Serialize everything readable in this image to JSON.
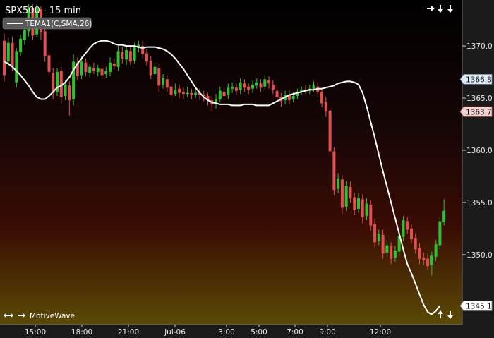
{
  "chart_title": "SPX500 - 15 min",
  "legend_label": "TEMA1(C,SMA,26)",
  "brand": "MotiveWave",
  "colors": {
    "up": "#2fc22f",
    "down": "#e05050",
    "indicator": "#ffffff",
    "bg_top": "#000000",
    "bg_mid": "#170606",
    "bg_red": "#3a0c04",
    "bg_bottom": "#5a4a05",
    "axis_bg": "#1a1a1a",
    "label_blue": "#dfe9f3",
    "label_pink": "#f1d0d0"
  },
  "icons": {
    "top_right": [
      "right-arrow-icon",
      "down-arrow-icon",
      "down-arrow-icon"
    ],
    "bottom_left": [
      "left-right-arrow-icon",
      "right-arrow-icon"
    ],
    "bottom_right": [
      "up-arrow-icon",
      "down-arrow-icon"
    ]
  },
  "chart_data": {
    "type": "candlestick",
    "title": "SPX500 - 15 min",
    "ylim": [
      1343.3,
      1374.4
    ],
    "x_ticks": [
      "15:00",
      "18:00",
      "21:00",
      "Jul-06",
      "3:00",
      "5:00",
      "7:00",
      "9:00",
      "12:00"
    ],
    "y_ticks": [
      1345.0,
      1350.0,
      1355.0,
      1360.0,
      1365.0,
      1370.0
    ],
    "price_labels": [
      {
        "value": 1366.8,
        "style": "blue"
      },
      {
        "value": 1363.7,
        "style": "pink"
      },
      {
        "value": 1345.1,
        "style": "white"
      }
    ],
    "candles": [
      [
        1370.5,
        1367.2,
        1371.2,
        1366.6
      ],
      [
        1368.5,
        1370.3,
        1370.8,
        1368.0
      ],
      [
        1370.3,
        1368.0,
        1370.9,
        1367.6
      ],
      [
        1366.5,
        1369.5,
        1369.8,
        1366.0
      ],
      [
        1369.4,
        1370.7,
        1371.1,
        1369.0
      ],
      [
        1370.6,
        1371.5,
        1372.3,
        1370.1
      ],
      [
        1371.4,
        1373.7,
        1374.0,
        1370.9
      ],
      [
        1373.6,
        1371.0,
        1374.0,
        1370.6
      ],
      [
        1371.1,
        1373.6,
        1374.0,
        1370.8
      ],
      [
        1373.5,
        1371.3,
        1373.8,
        1370.6
      ],
      [
        1371.4,
        1369.0,
        1371.9,
        1368.5
      ],
      [
        1369.1,
        1367.5,
        1369.5,
        1367.0
      ],
      [
        1367.4,
        1365.5,
        1367.9,
        1364.9
      ],
      [
        1365.6,
        1367.5,
        1367.9,
        1365.2
      ],
      [
        1367.6,
        1365.1,
        1368.0,
        1364.5
      ],
      [
        1365.2,
        1366.3,
        1366.7,
        1364.8
      ],
      [
        1366.2,
        1364.8,
        1366.6,
        1363.3
      ],
      [
        1364.9,
        1368.5,
        1369.2,
        1364.3
      ],
      [
        1368.4,
        1367.1,
        1368.9,
        1366.7
      ],
      [
        1367.2,
        1368.5,
        1369.0,
        1366.8
      ],
      [
        1368.4,
        1367.5,
        1368.8,
        1367.1
      ],
      [
        1367.4,
        1368.0,
        1368.3,
        1367.0
      ],
      [
        1367.9,
        1367.6,
        1368.4,
        1367.3
      ],
      [
        1367.5,
        1367.9,
        1368.2,
        1367.1
      ],
      [
        1367.8,
        1367.2,
        1368.2,
        1366.9
      ],
      [
        1367.3,
        1367.6,
        1368.0,
        1366.9
      ],
      [
        1367.5,
        1368.4,
        1368.9,
        1367.1
      ],
      [
        1368.3,
        1368.1,
        1368.8,
        1367.7
      ],
      [
        1368.0,
        1369.5,
        1370.0,
        1367.6
      ],
      [
        1369.4,
        1368.8,
        1369.9,
        1368.3
      ],
      [
        1368.7,
        1369.6,
        1370.0,
        1368.2
      ],
      [
        1369.5,
        1368.5,
        1369.9,
        1368.2
      ],
      [
        1368.6,
        1369.9,
        1370.3,
        1368.3
      ],
      [
        1369.8,
        1370.1,
        1370.5,
        1369.4
      ],
      [
        1370.0,
        1369.2,
        1370.5,
        1368.8
      ],
      [
        1369.3,
        1368.5,
        1369.7,
        1368.1
      ],
      [
        1368.6,
        1367.2,
        1369.0,
        1366.8
      ],
      [
        1367.3,
        1368.0,
        1368.4,
        1366.9
      ],
      [
        1367.9,
        1366.2,
        1368.3,
        1365.6
      ],
      [
        1366.3,
        1366.9,
        1367.3,
        1365.9
      ],
      [
        1366.8,
        1366.0,
        1367.2,
        1365.6
      ],
      [
        1366.1,
        1365.3,
        1366.6,
        1364.9
      ],
      [
        1365.4,
        1365.8,
        1366.4,
        1365.2
      ],
      [
        1365.9,
        1365.5,
        1366.3,
        1365.0
      ],
      [
        1365.6,
        1365.4,
        1366.0,
        1364.9
      ],
      [
        1365.4,
        1365.5,
        1366.1,
        1365.1
      ],
      [
        1365.5,
        1365.3,
        1365.9,
        1364.9
      ],
      [
        1365.3,
        1365.5,
        1366.0,
        1365.0
      ],
      [
        1365.5,
        1365.3,
        1365.9,
        1364.8
      ],
      [
        1365.3,
        1365.2,
        1365.7,
        1364.7
      ],
      [
        1365.2,
        1364.8,
        1365.5,
        1364.3
      ],
      [
        1364.8,
        1364.4,
        1365.2,
        1363.7
      ],
      [
        1364.4,
        1364.9,
        1365.4,
        1364.0
      ],
      [
        1364.9,
        1365.7,
        1366.1,
        1364.6
      ],
      [
        1365.6,
        1365.2,
        1366.0,
        1364.8
      ],
      [
        1365.3,
        1366.0,
        1366.4,
        1364.9
      ],
      [
        1365.9,
        1366.1,
        1366.5,
        1365.5
      ],
      [
        1366.0,
        1365.7,
        1366.4,
        1365.3
      ],
      [
        1365.8,
        1366.5,
        1366.9,
        1365.4
      ],
      [
        1366.4,
        1366.0,
        1366.8,
        1365.6
      ],
      [
        1366.1,
        1365.8,
        1366.4,
        1365.4
      ],
      [
        1365.9,
        1366.3,
        1366.7,
        1365.5
      ],
      [
        1366.2,
        1366.5,
        1366.9,
        1365.9
      ],
      [
        1366.4,
        1366.0,
        1366.8,
        1365.6
      ],
      [
        1366.1,
        1366.8,
        1367.2,
        1365.8
      ],
      [
        1366.7,
        1366.4,
        1367.1,
        1365.9
      ],
      [
        1366.3,
        1365.8,
        1366.7,
        1365.4
      ],
      [
        1365.7,
        1365.1,
        1366.1,
        1364.6
      ],
      [
        1365.1,
        1364.7,
        1365.5,
        1364.2
      ],
      [
        1364.8,
        1365.3,
        1365.7,
        1364.4
      ],
      [
        1365.3,
        1364.8,
        1365.7,
        1364.4
      ],
      [
        1364.9,
        1365.2,
        1365.6,
        1364.6
      ],
      [
        1365.2,
        1365.6,
        1365.9,
        1364.9
      ],
      [
        1365.6,
        1365.8,
        1366.1,
        1365.3
      ],
      [
        1365.8,
        1365.7,
        1366.2,
        1365.4
      ],
      [
        1365.7,
        1365.9,
        1366.3,
        1365.4
      ],
      [
        1365.9,
        1366.2,
        1366.6,
        1365.6
      ],
      [
        1366.1,
        1365.6,
        1366.5,
        1365.1
      ],
      [
        1365.6,
        1364.5,
        1365.9,
        1364.1
      ],
      [
        1364.6,
        1363.7,
        1365.1,
        1363.2
      ],
      [
        1363.8,
        1359.9,
        1364.1,
        1359.5
      ],
      [
        1359.9,
        1356.2,
        1360.3,
        1355.7
      ],
      [
        1356.3,
        1357.3,
        1357.8,
        1355.9
      ],
      [
        1357.2,
        1354.5,
        1357.6,
        1353.9
      ],
      [
        1354.6,
        1356.6,
        1357.1,
        1354.2
      ],
      [
        1356.5,
        1355.4,
        1357.0,
        1355.0
      ],
      [
        1355.5,
        1354.3,
        1355.9,
        1353.8
      ],
      [
        1354.4,
        1355.4,
        1355.9,
        1354.0
      ],
      [
        1355.3,
        1353.6,
        1355.8,
        1353.0
      ],
      [
        1353.7,
        1354.9,
        1355.4,
        1353.3
      ],
      [
        1354.8,
        1352.8,
        1355.2,
        1352.3
      ],
      [
        1352.9,
        1351.2,
        1353.4,
        1350.7
      ],
      [
        1351.3,
        1352.0,
        1352.4,
        1350.9
      ],
      [
        1351.9,
        1350.1,
        1352.4,
        1349.6
      ],
      [
        1350.2,
        1350.9,
        1351.4,
        1349.8
      ],
      [
        1350.8,
        1349.6,
        1351.2,
        1349.1
      ],
      [
        1349.7,
        1350.4,
        1350.8,
        1349.3
      ],
      [
        1350.3,
        1351.8,
        1352.2,
        1349.9
      ],
      [
        1351.7,
        1353.3,
        1353.7,
        1351.3
      ],
      [
        1353.2,
        1352.4,
        1353.6,
        1352.0
      ],
      [
        1352.5,
        1351.5,
        1352.9,
        1351.1
      ],
      [
        1351.6,
        1350.5,
        1352.0,
        1350.1
      ],
      [
        1350.6,
        1349.6,
        1351.1,
        1349.1
      ],
      [
        1349.7,
        1349.5,
        1350.2,
        1349.0
      ],
      [
        1349.6,
        1348.9,
        1350.1,
        1348.5
      ],
      [
        1349.0,
        1349.9,
        1350.3,
        1348.0
      ],
      [
        1349.8,
        1351.0,
        1351.4,
        1349.4
      ],
      [
        1350.9,
        1353.2,
        1353.6,
        1350.5
      ],
      [
        1353.1,
        1354.2,
        1355.3,
        1352.8
      ]
    ],
    "indicator": {
      "name": "TEMA1(C,SMA,26)",
      "values": [
        1368.5,
        1368.3,
        1368.0,
        1367.6,
        1367.2,
        1366.7,
        1366.2,
        1365.6,
        1365.1,
        1364.9,
        1364.9,
        1365.2,
        1365.6,
        1366.0,
        1366.2,
        1366.5,
        1367.0,
        1367.7,
        1368.3,
        1368.8,
        1369.3,
        1369.8,
        1370.2,
        1370.4,
        1370.5,
        1370.5,
        1370.4,
        1370.2,
        1370.1,
        1370.1,
        1370.0,
        1370.0,
        1370.0,
        1369.9,
        1369.8,
        1369.9,
        1369.9,
        1369.9,
        1369.8,
        1369.7,
        1369.5,
        1369.2,
        1368.8,
        1368.3,
        1367.8,
        1367.2,
        1366.6,
        1366.0,
        1365.5,
        1365.1,
        1364.8,
        1364.6,
        1364.5,
        1364.4,
        1364.4,
        1364.4,
        1364.3,
        1364.3,
        1364.3,
        1364.4,
        1364.4,
        1364.4,
        1364.3,
        1364.3,
        1364.3,
        1364.3,
        1364.5,
        1364.7,
        1364.9,
        1365.1,
        1365.3,
        1365.4,
        1365.5,
        1365.6,
        1365.7,
        1365.8,
        1365.8,
        1365.9,
        1365.9,
        1366.0,
        1366.1,
        1366.2,
        1366.4,
        1366.5,
        1366.6,
        1366.6,
        1366.5,
        1366.3,
        1365.5,
        1364.2,
        1362.7,
        1361.2,
        1359.6,
        1358.0,
        1356.5,
        1355.0,
        1353.5,
        1352.0,
        1350.5,
        1349.1,
        1348.2,
        1347.2,
        1346.2,
        1345.2,
        1344.5,
        1344.3,
        1344.6,
        1345.1
      ]
    }
  }
}
